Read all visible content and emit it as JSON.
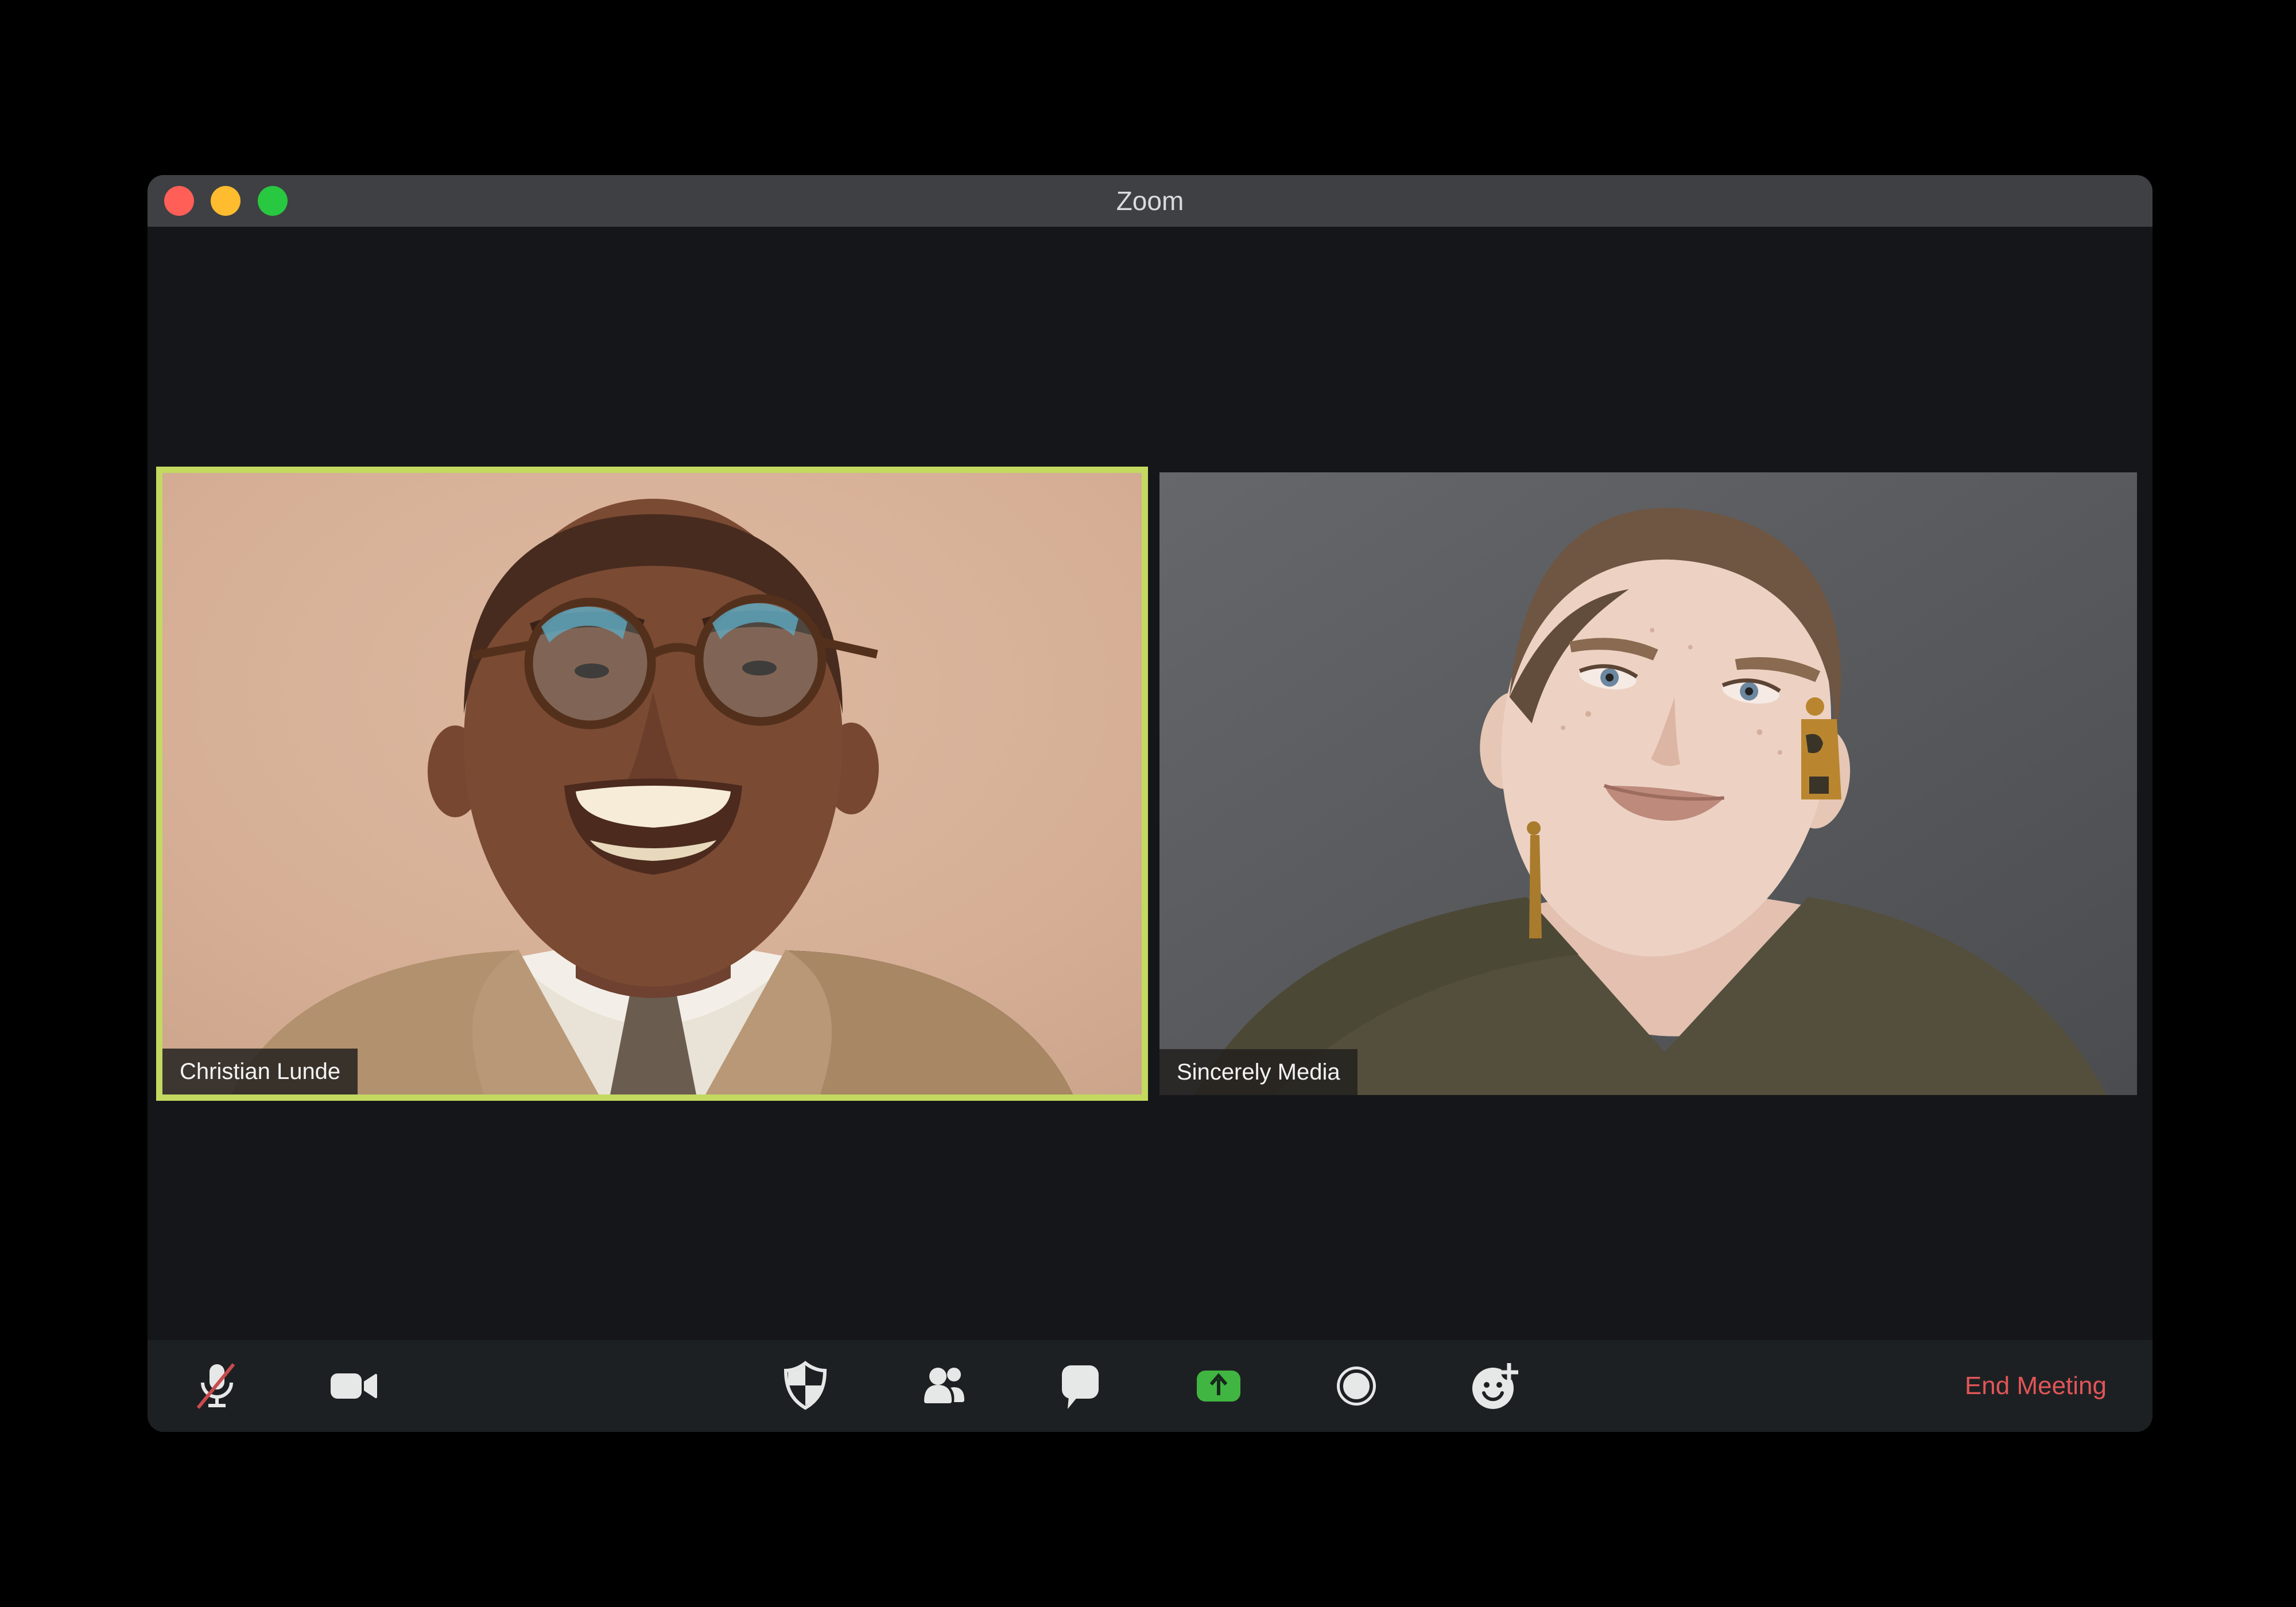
{
  "window": {
    "title": "Zoom",
    "controls": [
      {
        "name": "close",
        "color": "#ff5f57"
      },
      {
        "name": "minimize",
        "color": "#febc2e"
      },
      {
        "name": "maximize",
        "color": "#28c840"
      }
    ]
  },
  "participants": [
    {
      "name": "Christian Lunde",
      "active_speaker": true
    },
    {
      "name": "Sincerely Media",
      "active_speaker": false
    }
  ],
  "toolbar": {
    "buttons": [
      {
        "icon": "mic-muted-icon"
      },
      {
        "icon": "video-camera-icon"
      },
      {
        "icon": "security-shield-icon"
      },
      {
        "icon": "participants-icon"
      },
      {
        "icon": "chat-icon"
      },
      {
        "icon": "share-screen-icon"
      },
      {
        "icon": "record-icon"
      },
      {
        "icon": "reactions-icon"
      }
    ],
    "end_meeting_label": "End Meeting"
  },
  "colors": {
    "desktop": "#000000",
    "titlebar": "#3e4043",
    "window_background": "#141619",
    "toolbar_background": "#1d2022",
    "active_speaker_border": "#c3d960",
    "icon": "#e6e7e7",
    "mute_slash": "#c94b4d",
    "share_screen_green": "#41b541",
    "end_meeting_text": "#e15558",
    "name_badge_background": "rgba(35,33,30,0.85)",
    "name_badge_text": "#f3f3f3"
  }
}
